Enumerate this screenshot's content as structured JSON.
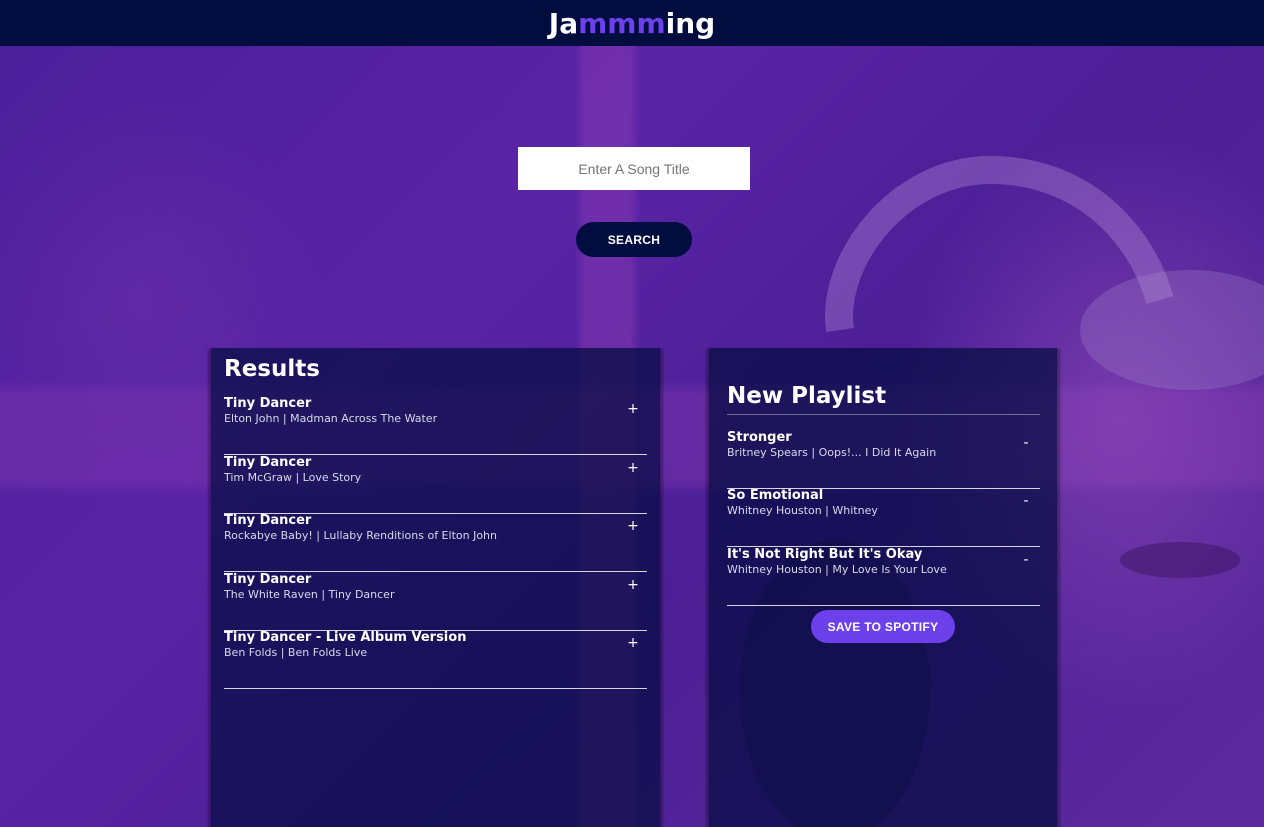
{
  "header": {
    "logo_prefix": "Ja",
    "logo_accent": "mmm",
    "logo_suffix": "ing"
  },
  "search": {
    "placeholder": "Enter A Song Title",
    "value": "",
    "button_label": "SEARCH"
  },
  "results": {
    "title": "Results",
    "tracks": [
      {
        "name": "Tiny Dancer",
        "info": "Elton John | Madman Across The Water",
        "action": "+"
      },
      {
        "name": "Tiny Dancer",
        "info": "Tim McGraw | Love Story",
        "action": "+"
      },
      {
        "name": "Tiny Dancer",
        "info": "Rockabye Baby! | Lullaby Renditions of Elton John",
        "action": "+"
      },
      {
        "name": "Tiny Dancer",
        "info": "The White Raven | Tiny Dancer",
        "action": "+"
      },
      {
        "name": "Tiny Dancer - Live Album Version",
        "info": "Ben Folds | Ben Folds Live",
        "action": "+"
      }
    ]
  },
  "playlist": {
    "title": "New Playlist",
    "tracks": [
      {
        "name": "Stronger",
        "info": "Britney Spears | Oops!... I Did It Again",
        "action": "-"
      },
      {
        "name": "So Emotional",
        "info": "Whitney Houston | Whitney",
        "action": "-"
      },
      {
        "name": "It's Not Right But It's Okay",
        "info": "Whitney Houston | My Love Is Your Love",
        "action": "-"
      }
    ],
    "save_label": "SAVE TO SPOTIFY"
  },
  "colors": {
    "header_bg": "#010c3f",
    "accent": "#6c41ec",
    "panel_bg": "rgba(1, 12, 63, 0.7)"
  }
}
